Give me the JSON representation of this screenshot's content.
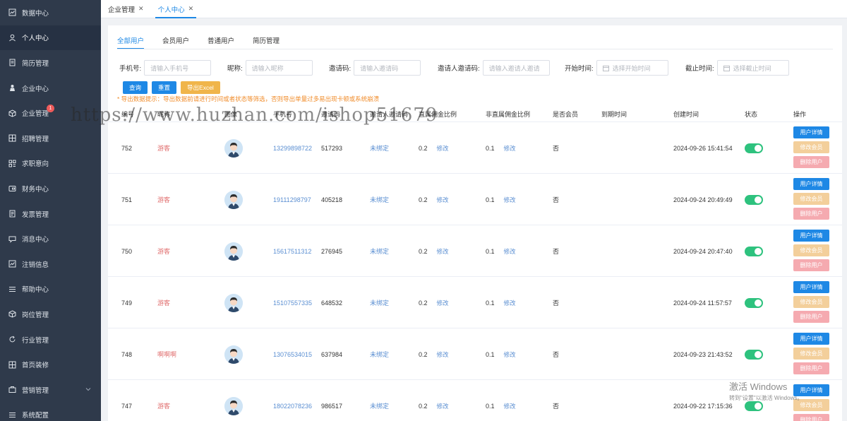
{
  "sidebar": {
    "items": [
      {
        "label": "数据中心",
        "icon": "chart-icon"
      },
      {
        "label": "个人中心",
        "icon": "user-icon",
        "active": true
      },
      {
        "label": "简历管理",
        "icon": "document-icon"
      },
      {
        "label": "企业中心",
        "icon": "person-icon"
      },
      {
        "label": "企业管理",
        "icon": "cube-icon",
        "badge": "1"
      },
      {
        "label": "招聘管理",
        "icon": "grid-icon"
      },
      {
        "label": "求职意向",
        "icon": "apps-icon"
      },
      {
        "label": "财务中心",
        "icon": "wallet-icon"
      },
      {
        "label": "发票管理",
        "icon": "invoice-icon"
      },
      {
        "label": "消息中心",
        "icon": "message-icon"
      },
      {
        "label": "注销信息",
        "icon": "chart-icon"
      },
      {
        "label": "帮助中心",
        "icon": "list-icon"
      },
      {
        "label": "岗位管理",
        "icon": "cube-icon"
      },
      {
        "label": "行业管理",
        "icon": "refresh-icon"
      },
      {
        "label": "首页装修",
        "icon": "grid-icon"
      },
      {
        "label": "营销管理",
        "icon": "market-icon",
        "expandable": true
      },
      {
        "label": "系统配置",
        "icon": "list-icon"
      }
    ]
  },
  "page_tabs": [
    {
      "label": "企业管理",
      "close": "✕"
    },
    {
      "label": "个人中心",
      "close": "✕",
      "active": true
    }
  ],
  "sub_tabs": [
    {
      "label": "全部用户",
      "active": true
    },
    {
      "label": "会员用户"
    },
    {
      "label": "普通用户"
    },
    {
      "label": "简历管理"
    }
  ],
  "filters": {
    "phone": {
      "label": "手机号:",
      "placeholder": "请输入手机号"
    },
    "nickname": {
      "label": "昵称:",
      "placeholder": "请输入昵称"
    },
    "invite_code": {
      "label": "邀请码:",
      "placeholder": "请输入邀请码"
    },
    "inviter_code": {
      "label": "邀请人邀请码:",
      "placeholder": "请输入邀请人邀请"
    },
    "start_time": {
      "label": "开始时间:",
      "placeholder": "选择开始时间"
    },
    "end_time": {
      "label": "截止时间:",
      "placeholder": "选择截止时间"
    }
  },
  "buttons": {
    "query": "查询",
    "reset": "重置",
    "export": "导出Excel"
  },
  "tip": "* 导出数据提示：导出数据前请进行时间或者状态等筛选，否则导出单量过多易出现卡顿或系统崩溃",
  "table": {
    "headers": [
      "编号",
      "昵称",
      "图像",
      "手机号",
      "邀请码",
      "邀请人邀请码",
      "直属佣金比例",
      "非直属佣金比例",
      "是否会员",
      "到期时间",
      "创建时间",
      "状态",
      "操作"
    ],
    "edit_label": "修改",
    "ops": {
      "detail": "用户详情",
      "member": "修改会员",
      "delete": "删除用户"
    },
    "rows": [
      {
        "id": "752",
        "nickname": "游客",
        "phone": "13299898722",
        "invite_code": "517293",
        "inviter": "未绑定",
        "direct_ratio": "0.2",
        "indirect_ratio": "0.1",
        "is_member": "否",
        "expire": "",
        "created": "2024-09-26 15:41:54",
        "enabled": true
      },
      {
        "id": "751",
        "nickname": "游客",
        "phone": "19111298797",
        "invite_code": "405218",
        "inviter": "未绑定",
        "direct_ratio": "0.2",
        "indirect_ratio": "0.1",
        "is_member": "否",
        "expire": "",
        "created": "2024-09-24 20:49:49",
        "enabled": true
      },
      {
        "id": "750",
        "nickname": "游客",
        "phone": "15617511312",
        "invite_code": "276945",
        "inviter": "未绑定",
        "direct_ratio": "0.2",
        "indirect_ratio": "0.1",
        "is_member": "否",
        "expire": "",
        "created": "2024-09-24 20:47:40",
        "enabled": true
      },
      {
        "id": "749",
        "nickname": "游客",
        "phone": "15107557335",
        "invite_code": "648532",
        "inviter": "未绑定",
        "direct_ratio": "0.2",
        "indirect_ratio": "0.1",
        "is_member": "否",
        "expire": "",
        "created": "2024-09-24 11:57:57",
        "enabled": true
      },
      {
        "id": "748",
        "nickname": "啊啊啊",
        "phone": "13076534015",
        "invite_code": "637984",
        "inviter": "未绑定",
        "direct_ratio": "0.2",
        "indirect_ratio": "0.1",
        "is_member": "否",
        "expire": "",
        "created": "2024-09-23 21:43:52",
        "enabled": true
      },
      {
        "id": "747",
        "nickname": "游客",
        "phone": "18022078236",
        "invite_code": "986517",
        "inviter": "未绑定",
        "direct_ratio": "0.2",
        "indirect_ratio": "0.1",
        "is_member": "否",
        "expire": "",
        "created": "2024-09-22 17:15:36",
        "enabled": true
      }
    ]
  },
  "overlay": {
    "watermark": "https://www.huzhan.com/ishop51679",
    "activate_title": "激活 Windows",
    "activate_sub": "转到\"设置\"以激活 Windows。"
  },
  "colors": {
    "primary": "#1e88e5",
    "sidebar_bg": "#2f3a4b",
    "switch_on": "#2ec27e",
    "warning": "#f08c2b"
  }
}
